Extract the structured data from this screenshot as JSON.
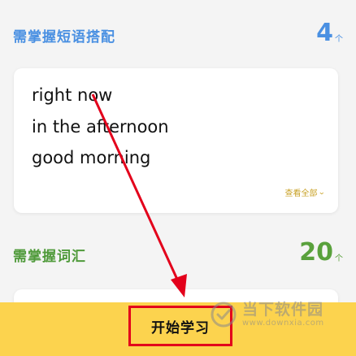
{
  "phrases_section": {
    "title": "需掌握短语搭配",
    "count": "4",
    "unit": "个"
  },
  "phrase_card": {
    "items": [
      "right now",
      "in the afternoon",
      "good morning"
    ],
    "view_all_label": "查看全部"
  },
  "vocab_section": {
    "title": "需掌握词汇",
    "count": "20",
    "unit": "个"
  },
  "bottom_bar": {
    "start_label": "开始学习"
  },
  "watermark": {
    "title": "当下软件园",
    "url": "www.downxia.com"
  },
  "colors": {
    "phrases_accent": "#4a90e2",
    "vocab_accent": "#59a13c",
    "bottom_bar": "#fcd34e",
    "highlight_red": "#e3001b",
    "view_all": "#c9a227"
  }
}
